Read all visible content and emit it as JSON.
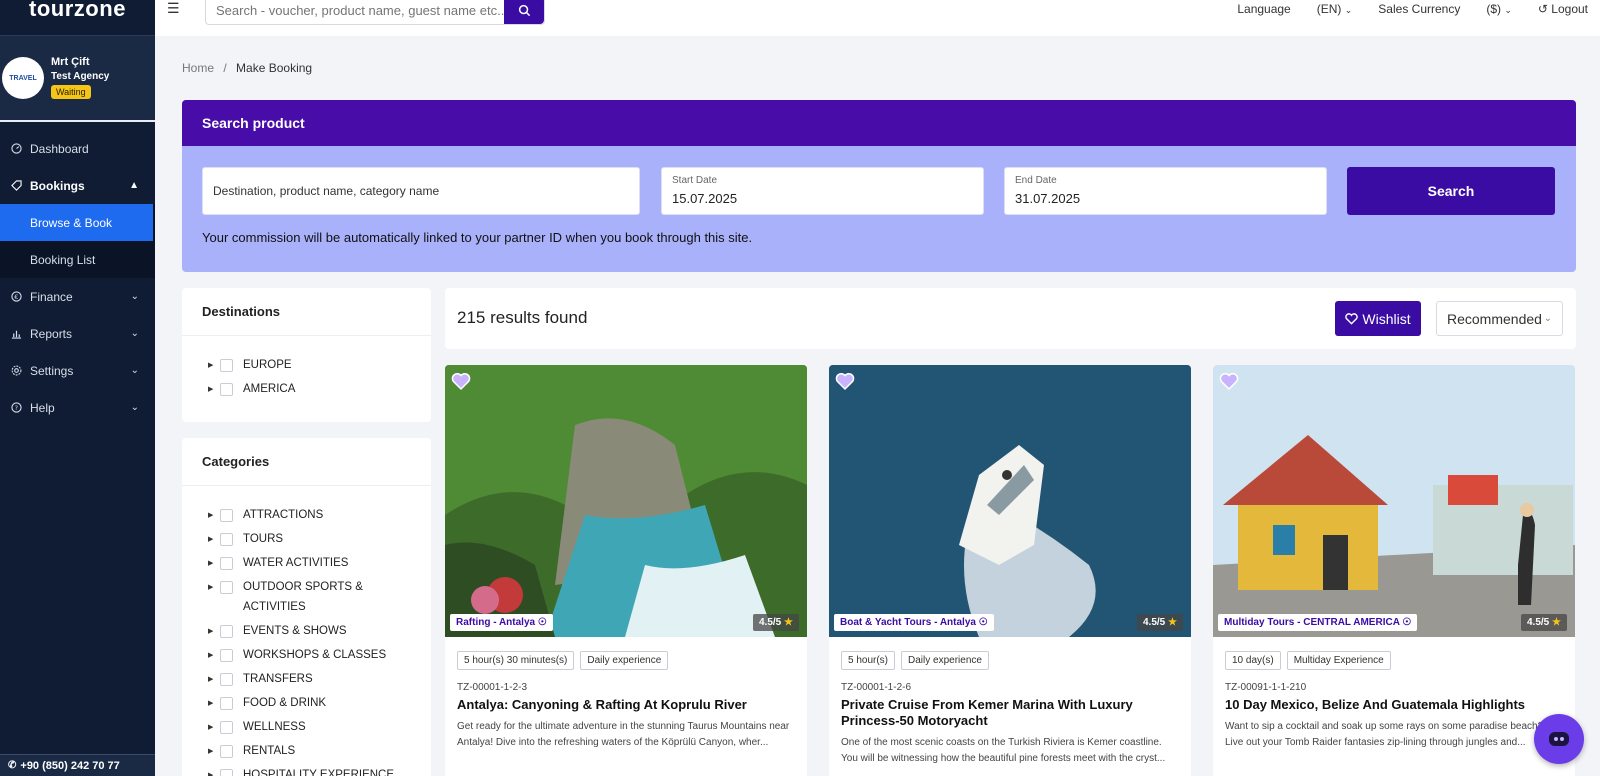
{
  "sidebar": {
    "logo": "tourzone",
    "profile": {
      "avatar_text": "TRAVEL",
      "name": "Mrt Çift",
      "agency": "Test Agency",
      "status": "Waiting"
    },
    "nav": {
      "dashboard": "Dashboard",
      "bookings": "Bookings",
      "browse_book": "Browse & Book",
      "booking_list": "Booking List",
      "finance": "Finance",
      "reports": "Reports",
      "settings": "Settings",
      "help": "Help"
    },
    "phone": "+90 (850) 242 70 77"
  },
  "topbar": {
    "search_placeholder": "Search - voucher, product name, guest name etc..",
    "language_label": "Language",
    "language_value": "(EN)",
    "currency_label": "Sales Currency",
    "currency_value": "($)",
    "logout": "Logout"
  },
  "breadcrumb": {
    "home": "Home",
    "separator": "/",
    "current": "Make Booking"
  },
  "search_panel": {
    "title": "Search product",
    "destination_placeholder": "Destination, product name, category name",
    "start_label": "Start Date",
    "start_value": "15.07.2025",
    "end_label": "End Date",
    "end_value": "31.07.2025",
    "button": "Search",
    "commission_note": "Your commission will be automatically linked to your partner ID when you book through this site."
  },
  "destinations": {
    "title": "Destinations",
    "items": [
      "EUROPE",
      "AMERICA"
    ]
  },
  "categories": {
    "title": "Categories",
    "items": [
      "ATTRACTIONS",
      "TOURS",
      "WATER ACTIVITIES",
      "OUTDOOR SPORTS & ACTIVITIES",
      "EVENTS & SHOWS",
      "WORKSHOPS & CLASSES",
      "TRANSFERS",
      "FOOD & DRINK",
      "WELLNESS",
      "RENTALS",
      "HOSPITALITY EXPERIENCE"
    ]
  },
  "results": {
    "count": "215 results found",
    "wishlist": "Wishlist",
    "sort": "Recommended"
  },
  "cards": [
    {
      "location": "Rafting - Antalya",
      "rating": "4.5/5",
      "chips": [
        "5 hour(s) 30 minutes(s)",
        "Daily experience"
      ],
      "code": "TZ-00001-1-2-3",
      "title": "Antalya: Canyoning & Rafting At Koprulu River",
      "description": "Get ready for the ultimate adventure in the stunning Taurus Mountains near Antalya! Dive into the refreshing waters of the Köprülü Canyon, wher..."
    },
    {
      "location": "Boat & Yacht Tours - Antalya",
      "rating": "4.5/5",
      "chips": [
        "5 hour(s)",
        "Daily experience"
      ],
      "code": "TZ-00001-1-2-6",
      "title": "Private Cruise From Kemer Marina With Luxury Princess-50 Motoryacht",
      "description": "One of the most scenic coasts on the Turkish Riviera is Kemer coastline. You will be witnessing how the beautiful pine forests meet with the cryst..."
    },
    {
      "location": "Multiday Tours - CENTRAL AMERICA",
      "rating": "4.5/5",
      "chips": [
        "10 day(s)",
        "Multiday Experience"
      ],
      "code": "TZ-00091-1-1-210",
      "title": "10 Day Mexico, Belize And Guatemala Highlights",
      "description": "Want to sip a cocktail and soak up some rays on some paradise beach? Live out your Tomb Raider fantasies zip-lining through jungles and..."
    }
  ],
  "colors": {
    "primary": "#3a0ca3",
    "header_purple": "#480ca8",
    "panel_lavender": "#a9b1fb",
    "sidebar": "#0f1c33",
    "active_nav": "#1e6bf0"
  }
}
